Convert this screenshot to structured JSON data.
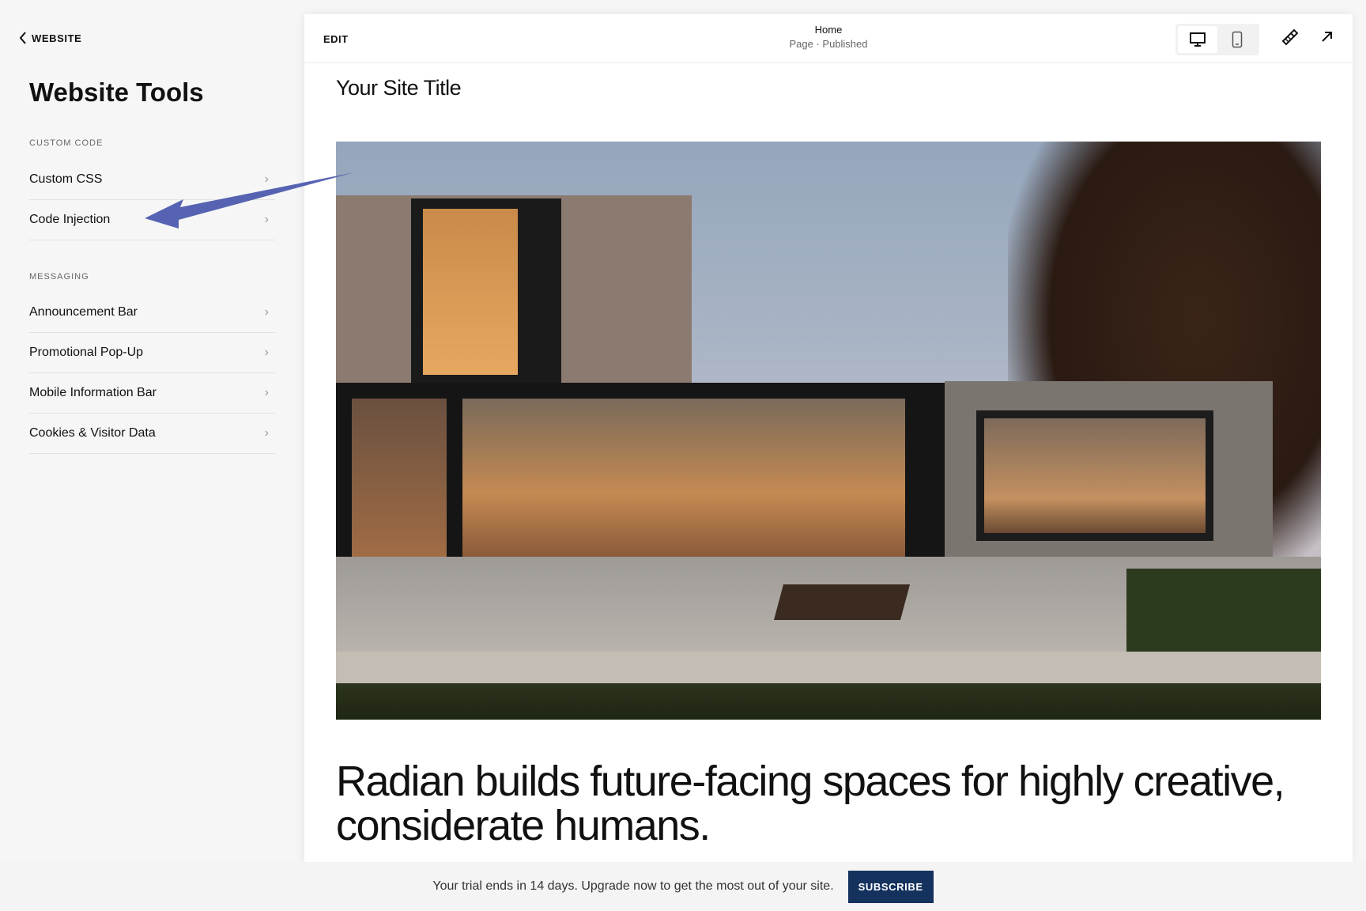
{
  "sidebar": {
    "back_label": "WEBSITE",
    "title": "Website Tools",
    "sections": [
      {
        "label": "CUSTOM CODE",
        "items": [
          "Custom CSS",
          "Code Injection"
        ]
      },
      {
        "label": "MESSAGING",
        "items": [
          "Announcement Bar",
          "Promotional Pop-Up",
          "Mobile Information Bar",
          "Cookies & Visitor Data"
        ]
      }
    ]
  },
  "preview": {
    "edit_label": "EDIT",
    "page_name": "Home",
    "page_status": "Page · Published",
    "site_title": "Your Site Title",
    "headline": "Radian builds future-facing spaces for highly creative, considerate humans."
  },
  "trial_bar": {
    "message": "Your trial ends in 14 days. Upgrade now to get the most out of your site.",
    "button": "SUBSCRIBE"
  },
  "colors": {
    "annotation_arrow": "#5663b2",
    "subscribe": "#15325f"
  }
}
